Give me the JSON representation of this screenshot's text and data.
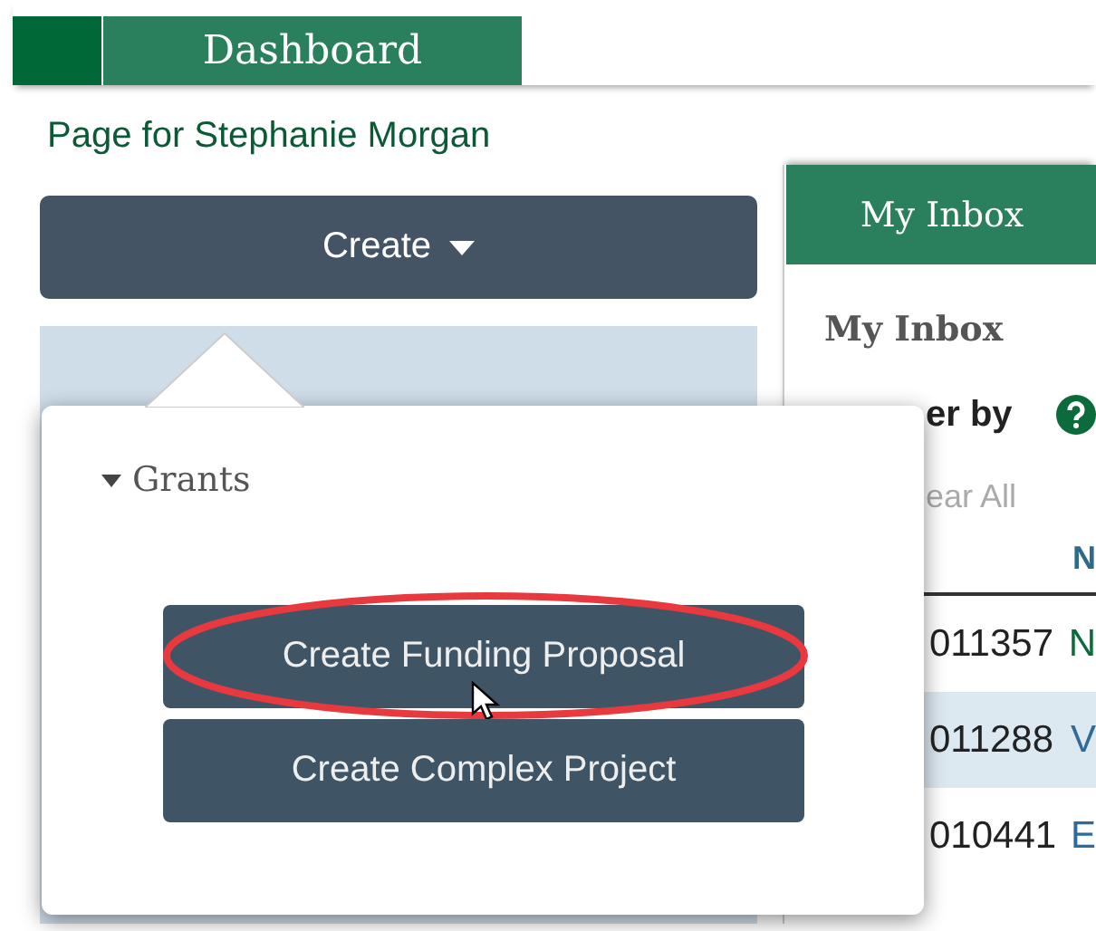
{
  "nav": {
    "tab": "Dashboard"
  },
  "page_title": "Page for Stephanie Morgan",
  "create_button": {
    "label": "Create",
    "expanded": true
  },
  "create_menu": {
    "group": {
      "label": "Grants",
      "expanded": true
    },
    "items": [
      {
        "label": "Create Funding Proposal",
        "highlighted": true
      },
      {
        "label": "Create Complex Project",
        "highlighted": false
      }
    ]
  },
  "inbox": {
    "tab": "My Inbox",
    "heading": "My Inbox",
    "filter_label": "er by",
    "clear_link": "ear All",
    "column_header": "N",
    "rows": [
      {
        "id": "011357",
        "name": "N"
      },
      {
        "id": "011288",
        "name": "V"
      },
      {
        "id": "010441",
        "name": "E"
      }
    ]
  }
}
